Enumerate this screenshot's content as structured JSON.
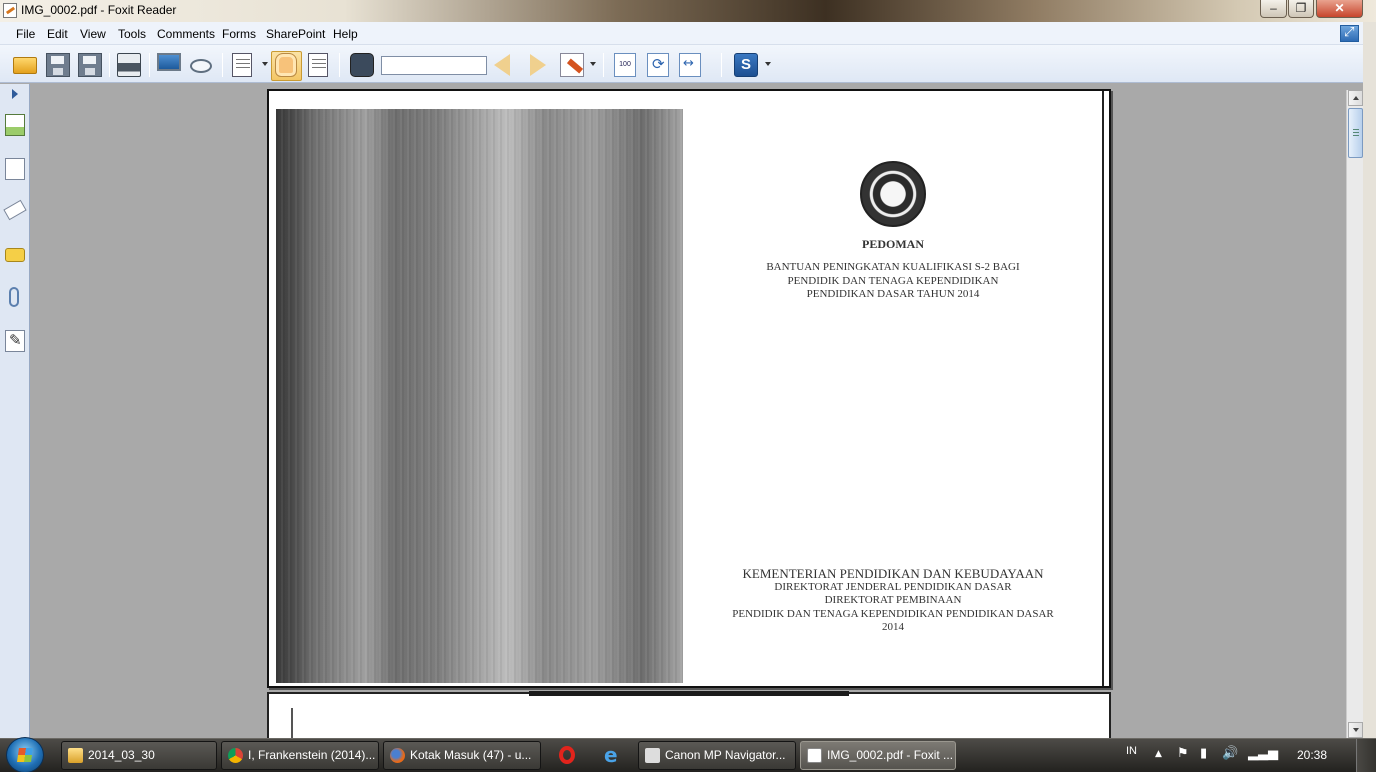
{
  "window": {
    "title": "IMG_0002.pdf - Foxit Reader",
    "min_label": "–",
    "max_label": "❐",
    "close_label": "✕"
  },
  "menu": {
    "items": [
      "File",
      "Edit",
      "View",
      "Tools",
      "Comments",
      "Forms",
      "SharePoint",
      "Help"
    ]
  },
  "toolbar": {
    "find_value": "",
    "zoom_label": "100"
  },
  "document": {
    "cover_title": "PEDOMAN",
    "cover_subtitle": [
      "BANTUAN PENINGKATAN KUALIFIKASI S-2 BAGI",
      "PENDIDIK DAN TENAGA KEPENDIDIKAN",
      "PENDIDIKAN DASAR TAHUN 2014"
    ],
    "ministry": [
      "KEMENTERIAN PENDIDIKAN DAN KEBUDAYAAN",
      "DIREKTORAT JENDERAL PENDIDIKAN DASAR",
      "DIREKTORAT PEMBINAAN",
      "PENDIDIK DAN TENAGA KEPENDIDIKAN PENDIDIKAN DASAR",
      "2014"
    ]
  },
  "taskbar": {
    "tasks": [
      {
        "label": "2014_03_30",
        "icon": "folder-icon"
      },
      {
        "label": "I, Frankenstein (2014)...",
        "icon": "chrome-icon"
      },
      {
        "label": "Kotak Masuk (47) - u...",
        "icon": "firefox-icon"
      },
      {
        "label": "Canon MP Navigator...",
        "icon": "canon-icon"
      },
      {
        "label": "IMG_0002.pdf - Foxit ...",
        "icon": "foxit-icon"
      }
    ],
    "language": "IN",
    "clock": "20:38"
  }
}
